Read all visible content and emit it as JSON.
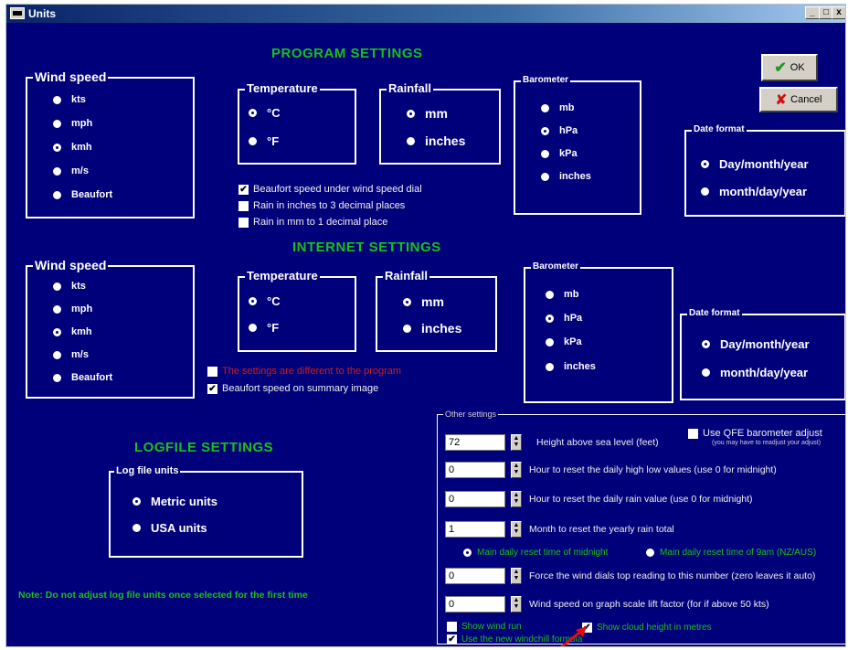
{
  "window": {
    "title": "Units",
    "controls": [
      "_",
      "□",
      "x"
    ]
  },
  "buttons": {
    "ok": "OK",
    "cancel": "Cancel"
  },
  "program": {
    "title": "PROGRAM SETTINGS",
    "wind": {
      "title": "Wind speed",
      "options": [
        "kts",
        "mph",
        "kmh",
        "m/s",
        "Beaufort"
      ],
      "selected": "kmh"
    },
    "temperature": {
      "title": "Temperature",
      "options": [
        "°C",
        "°F"
      ],
      "selected": "°C"
    },
    "rainfall": {
      "title": "Rainfall",
      "options": [
        "mm",
        "inches"
      ],
      "selected": "mm"
    },
    "barometer": {
      "title": "Barometer",
      "options": [
        "mb",
        "hPa",
        "kPa",
        "inches"
      ],
      "selected": "hPa"
    },
    "date": {
      "title": "Date format",
      "options": [
        "Day/month/year",
        "month/day/year"
      ],
      "selected": "Day/month/year"
    },
    "checks": [
      {
        "label": "Beaufort speed under wind speed dial",
        "checked": true
      },
      {
        "label": "Rain in inches to 3 decimal places",
        "checked": false
      },
      {
        "label": "Rain in mm to 1 decimal place",
        "checked": false
      }
    ]
  },
  "internet": {
    "title": "INTERNET SETTINGS",
    "wind": {
      "title": "Wind speed",
      "options": [
        "kts",
        "mph",
        "kmh",
        "m/s",
        "Beaufort"
      ],
      "selected": "kmh"
    },
    "temperature": {
      "title": "Temperature",
      "options": [
        "°C",
        "°F"
      ],
      "selected": "°C"
    },
    "rainfall": {
      "title": "Rainfall",
      "options": [
        "mm",
        "inches"
      ],
      "selected": "mm"
    },
    "barometer": {
      "title": "Barometer",
      "options": [
        "mb",
        "hPa",
        "kPa",
        "inches"
      ],
      "selected": "hPa"
    },
    "date": {
      "title": "Date format",
      "options": [
        "Day/month/year",
        "month/day/year"
      ],
      "selected": "Day/month/year"
    },
    "checks": [
      {
        "label": "The settings are different to the program",
        "checked": false,
        "color": "#c81e1e"
      },
      {
        "label": "Beaufort speed on summary image",
        "checked": true
      }
    ]
  },
  "logfile": {
    "title": "LOGFILE SETTINGS",
    "group_title": "Log file units",
    "options": [
      "Metric units",
      "USA units"
    ],
    "selected": "Metric units",
    "note": "Note:  Do not adjust log file units once selected for the first time"
  },
  "other": {
    "title": "Other settings",
    "height": {
      "value": "72",
      "label": "Height above sea level (feet)"
    },
    "qfe": {
      "label": "Use QFE  barometer adjust",
      "sub": "(you may have to readjust your adjust)",
      "checked": false
    },
    "spinners": [
      {
        "value": "0",
        "label": "Hour to reset the daily high low values (use 0 for midnight)"
      },
      {
        "value": "0",
        "label": "Hour to reset the daily rain value (use 0 for midnight)"
      },
      {
        "value": "1",
        "label": "Month to reset the yearly rain total"
      }
    ],
    "reset_options": [
      "Main daily reset time of midnight",
      "Main daily reset time of 9am (NZ/AUS)"
    ],
    "reset_selected": "Main daily reset time of midnight",
    "spinners2": [
      {
        "value": "0",
        "label": "Force the wind dials top reading to this number (zero leaves it auto)"
      },
      {
        "value": "0",
        "label": "Wind speed on graph scale lift factor (for if above 50 kts)"
      }
    ],
    "checks": [
      {
        "label": "Show wind run",
        "checked": false
      },
      {
        "label": "Show cloud height in metres",
        "checked": true
      },
      {
        "label": "Use the new windchill formula",
        "checked": true
      }
    ]
  },
  "colors": {
    "background": "#00007a",
    "section_title": "#18c018",
    "warning": "#c81e1e",
    "pointer": "#e01010"
  }
}
